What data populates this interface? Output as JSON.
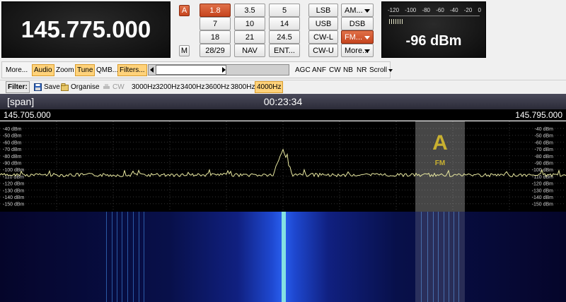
{
  "frequency": "145.775.000",
  "vfo": {
    "a_label": "A",
    "m_label": "M"
  },
  "bands": [
    "1.8",
    "3.5",
    "5",
    "7",
    "10",
    "14",
    "18",
    "21",
    "24.5",
    "28/29",
    "NAV",
    "ENT..."
  ],
  "modes": {
    "lsb": "LSB",
    "am": "AM...",
    "usb": "USB",
    "dsb": "DSB",
    "cwl": "CW-L",
    "fm": "FM...",
    "cwu": "CW-U",
    "more": "More..."
  },
  "smeter": {
    "scale": [
      "-120",
      "-100",
      "-80",
      "-60",
      "-40",
      "-20",
      "0"
    ],
    "value": "-96 dBm",
    "level_fraction": 0.15
  },
  "toolbar": {
    "more": "More...",
    "audio": "Audio",
    "zoom": "Zoom",
    "tune": "Tune",
    "qmb": "QMB...",
    "filters": "Filters...",
    "agc": "AGC",
    "anf": "ANF",
    "cw": "CW",
    "nb": "NB",
    "nr": "NR",
    "scroll": "Scroll"
  },
  "filter_bar": {
    "label": "Filter:",
    "save": "Save",
    "organise": "Organise",
    "cw": "CW",
    "widths": [
      "3000Hz",
      "3200Hz",
      "3400Hz",
      "3600Hz",
      "3800Hz",
      "4000Hz"
    ]
  },
  "span_label": "[span]",
  "clock": "00:23:34",
  "freq_left": "145.705.000",
  "freq_right": "145.795.000",
  "dbm_labels": [
    "-40 dBm",
    "-50 dBm",
    "-60 dBm",
    "-70 dBm",
    "-80 dBm",
    "-90 dBm",
    "-100 dBm",
    "-110 dBm",
    "-120 dBm",
    "-130 dBm",
    "-140 dBm",
    "-150 dBm"
  ],
  "vfo_marker": {
    "letter": "A",
    "mode": "FM"
  },
  "colors": {
    "accent": "#c6451f",
    "highlight": "#ffd27a",
    "trace": "#e8e8a0"
  }
}
